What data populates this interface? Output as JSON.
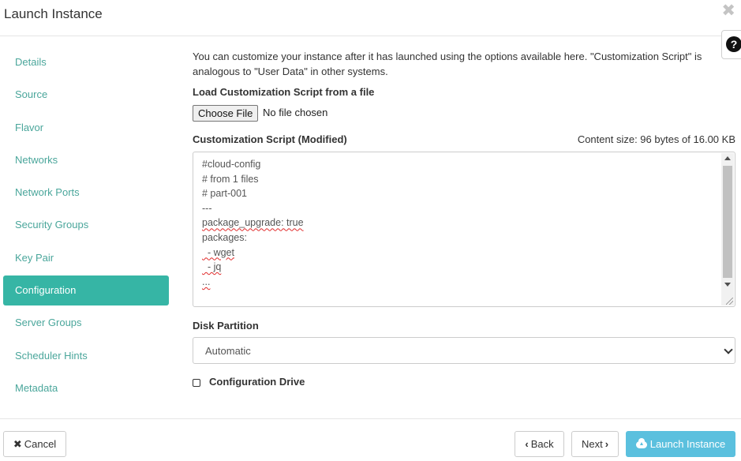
{
  "window": {
    "title": "Launch Instance",
    "close_icon": "✖",
    "help_icon": "?"
  },
  "nav": {
    "items": [
      {
        "label": "Details"
      },
      {
        "label": "Source"
      },
      {
        "label": "Flavor"
      },
      {
        "label": "Networks"
      },
      {
        "label": "Network Ports"
      },
      {
        "label": "Security Groups"
      },
      {
        "label": "Key Pair"
      },
      {
        "label": "Configuration"
      },
      {
        "label": "Server Groups"
      },
      {
        "label": "Scheduler Hints"
      },
      {
        "label": "Metadata"
      }
    ],
    "active": "Configuration"
  },
  "config": {
    "intro": "You can customize your instance after it has launched using the options available here. \"Customization Script\" is analogous to \"User Data\" in other systems.",
    "load_label": "Load Customization Script from a file",
    "choose_file": "Choose File",
    "file_status": "No file chosen",
    "script_label": "Customization Script (Modified)",
    "content_size": "Content size: 96 bytes of 16.00 KB",
    "script_lines": [
      "#cloud-config",
      "# from 1 files",
      "# part-001",
      "---",
      "package_upgrade: true",
      "packages:",
      "  - wget",
      "  - jq",
      "..."
    ],
    "disk_partition_label": "Disk Partition",
    "disk_partition_value": "Automatic",
    "config_drive_label": "Configuration Drive",
    "config_drive_checked": false
  },
  "footer": {
    "cancel": "Cancel",
    "back": "Back",
    "next": "Next",
    "launch": "Launch Instance"
  },
  "colors": {
    "accent": "#36b5a5",
    "link": "#4aa69b",
    "launch_button": "#5bc0de"
  }
}
